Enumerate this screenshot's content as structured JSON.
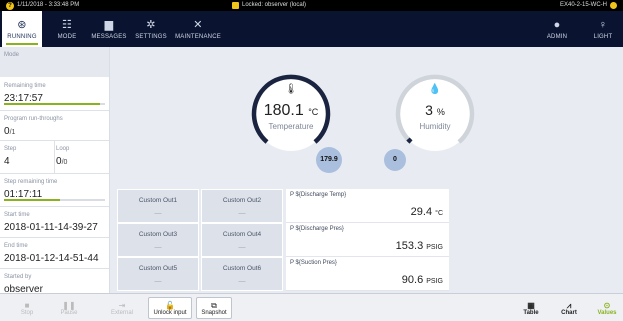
{
  "status": {
    "datetime": "1/11/2018 - 3:33:48 PM",
    "lock_text": "Locked: observer (local)",
    "device_id": "EX40-2-15-WC-H"
  },
  "nav": {
    "items": [
      {
        "label": "RUNNING",
        "icon": "running-icon"
      },
      {
        "label": "MODE",
        "icon": "sliders-icon"
      },
      {
        "label": "MESSAGES",
        "icon": "message-icon"
      },
      {
        "label": "SETTINGS",
        "icon": "gear-icon"
      },
      {
        "label": "MAINTENANCE",
        "icon": "tools-icon"
      }
    ],
    "admin": "ADMIN",
    "light": "LIGHT"
  },
  "sidebar": {
    "mode_label": "Mode",
    "remaining_time_label": "Remaining time",
    "remaining_time": "23:17:57",
    "remaining_time_progress": 0.95,
    "program_runthroughs_label": "Program run-throughs",
    "program_runthroughs_value": "0",
    "program_runthroughs_total": "/1",
    "step_label": "Step",
    "step_value": "4",
    "loop_label": "Loop",
    "loop_value": "0",
    "loop_total": "/0",
    "step_remaining_label": "Step remaining time",
    "step_remaining": "01:17:11",
    "step_remaining_progress": 0.55,
    "start_time_label": "Start time",
    "start_time": "2018-01-11-14-39-27",
    "end_time_label": "End time",
    "end_time": "2018-01-12-14-51-44",
    "started_by_label": "Started by",
    "started_by": "observer"
  },
  "gauges": {
    "temperature": {
      "value": "180.1",
      "unit": "°C",
      "label": "Temperature",
      "setpoint": "179.9"
    },
    "humidity": {
      "value": "3",
      "unit": "%",
      "label": "Humidity",
      "setpoint": "0"
    }
  },
  "custom_outputs": [
    {
      "label": "Custom Out1",
      "value": "—"
    },
    {
      "label": "Custom Out2",
      "value": "—"
    },
    {
      "label": "Custom Out3",
      "value": "—"
    },
    {
      "label": "Custom Out4",
      "value": "—"
    },
    {
      "label": "Custom Out5",
      "value": "—"
    },
    {
      "label": "Custom Out6",
      "value": "—"
    }
  ],
  "params": [
    {
      "label": "P ${Discharge Temp}",
      "value": "29.4",
      "unit": "°C"
    },
    {
      "label": "P ${Discharge Pres}",
      "value": "153.3",
      "unit": "PSIG"
    },
    {
      "label": "P ${Suction Pres}",
      "value": "90.6",
      "unit": "PSIG"
    }
  ],
  "bottom": {
    "stop": "Stop",
    "pause": "Pause",
    "external": "External",
    "unlock": "Unlock input",
    "snapshot": "Snapshot",
    "table": "Table",
    "chart": "Chart",
    "values": "Values"
  },
  "colors": {
    "accent": "#8ab21e",
    "nav_bg": "#0a1430",
    "bubble": "#a9bfdd"
  }
}
